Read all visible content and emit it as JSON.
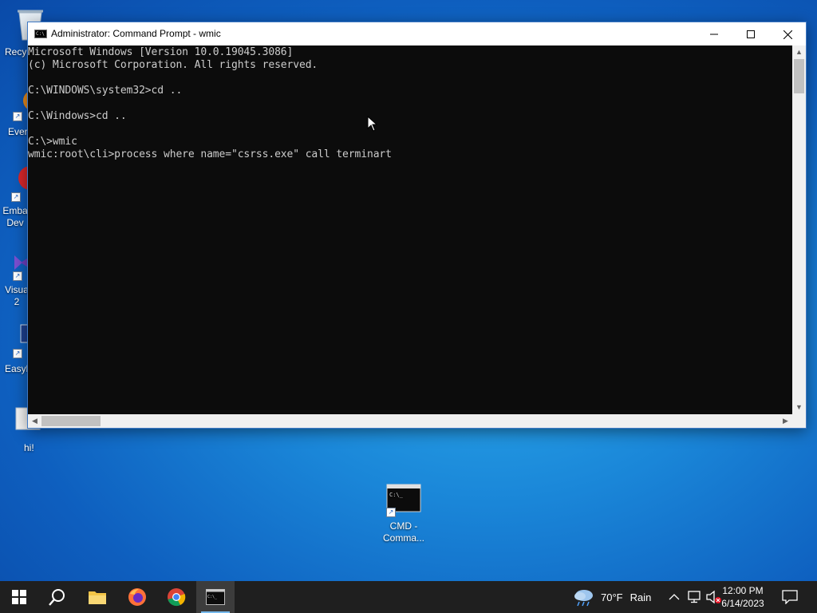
{
  "desktop": {
    "icons": [
      {
        "label": "Recy"
      },
      {
        "label": "Ever"
      },
      {
        "label": "Emba Dev"
      },
      {
        "label": "Visua 2"
      },
      {
        "label": "Easyb"
      },
      {
        "label": "hi!"
      },
      {
        "label": "CMD - Comma..."
      }
    ]
  },
  "window": {
    "title": "Administrator:  Command Prompt - wmic",
    "app_icon_text": "C:\\",
    "controls": {
      "minimize": "—",
      "maximize": "☐",
      "close": "✕"
    },
    "console_lines": [
      "Microsoft Windows [Version 10.0.19045.3086]",
      "(c) Microsoft Corporation. All rights reserved.",
      "",
      "C:\\WINDOWS\\system32>cd ..",
      "",
      "C:\\Windows>cd ..",
      "",
      "C:\\>wmic",
      "wmic:root\\cli>process where name=\"csrss.exe\" call terminart"
    ],
    "scroll_arrows": {
      "up": "▲",
      "down": "▼",
      "left": "◀",
      "right": "▶"
    }
  },
  "taskbar": {
    "weather": {
      "temp": "70°F",
      "condition": "Rain"
    },
    "clock": {
      "time": "12:00 PM",
      "date": "6/14/2023"
    },
    "tray_chevron": "^"
  }
}
